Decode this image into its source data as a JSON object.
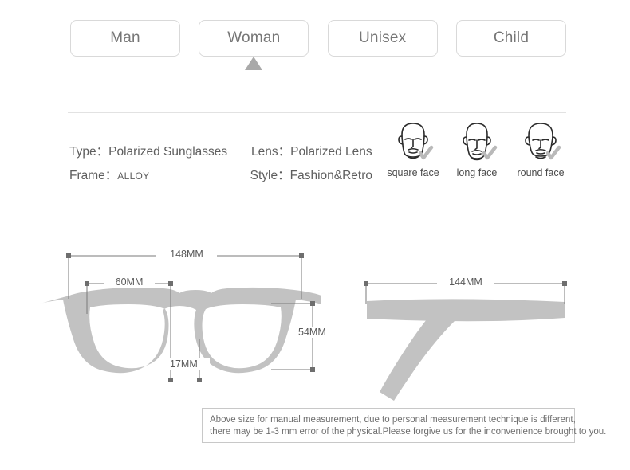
{
  "tabs": [
    {
      "label": "Man",
      "selected": false
    },
    {
      "label": "Woman",
      "selected": true
    },
    {
      "label": "Unisex",
      "selected": false
    },
    {
      "label": "Child",
      "selected": false
    }
  ],
  "specs": [
    [
      {
        "label": "Type：",
        "value": "Polarized Sunglasses",
        "small": false
      },
      {
        "label": "Lens：",
        "value": "Polarized Lens",
        "small": false
      }
    ],
    [
      {
        "label": "Frame：",
        "value": "ALLOY",
        "small": true
      },
      {
        "label": "Style：",
        "value": "Fashion&Retro",
        "small": false
      }
    ]
  ],
  "face_shapes": [
    {
      "label": "square face",
      "icon": "face-square-icon",
      "check": true
    },
    {
      "label": "long face",
      "icon": "face-long-icon",
      "check": true
    },
    {
      "label": "round face",
      "icon": "face-round-icon",
      "check": true
    }
  ],
  "dimensions": {
    "front_width": "148MM",
    "lens_width": "60MM",
    "lens_height": "54MM",
    "bridge_width": "17MM",
    "temple_length": "144MM"
  },
  "disclaimer": {
    "line1": "Above size for manual measurement, due to personal measurement technique is different,",
    "line2": "there may be 1-3 mm error of the physical.Please forgive us for the inconvenience brought to you."
  },
  "colors": {
    "frame": "#c2c2c2",
    "marker": "#a9a9a9",
    "dim_line": "#7a7a7a",
    "border": "#d9d9d9",
    "text": "#5e5e5e"
  }
}
